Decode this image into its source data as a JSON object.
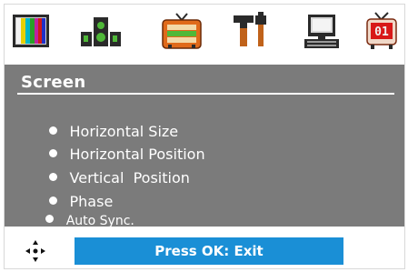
{
  "tabs": [
    {
      "icon": "color-bars-icon"
    },
    {
      "icon": "speakers-icon"
    },
    {
      "icon": "tv-icon"
    },
    {
      "icon": "tools-icon"
    },
    {
      "icon": "computer-icon"
    },
    {
      "icon": "clock-tv-icon",
      "display_text": "01"
    }
  ],
  "menu": {
    "title": "Screen",
    "items": [
      {
        "label": "Horizontal Size"
      },
      {
        "label": "Horizontal Position"
      },
      {
        "label": "Vertical  Position"
      },
      {
        "label": "Phase"
      },
      {
        "label": "Auto Sync."
      }
    ]
  },
  "footer": {
    "nav_icon": "four-way-arrow-icon",
    "hint": "Press OK: Exit"
  },
  "colors": {
    "menu_bg": "#7b7b7b",
    "hint_bg": "#1a8fd6",
    "text": "#ffffff"
  }
}
